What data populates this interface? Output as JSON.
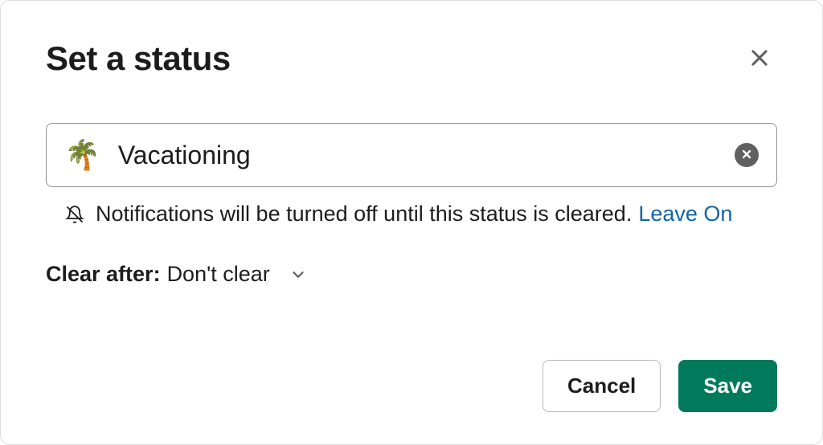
{
  "header": {
    "title": "Set a status"
  },
  "status": {
    "emoji": "🌴",
    "value": "Vacationing"
  },
  "notification": {
    "text": "Notifications will be turned off until this status is cleared.",
    "leave_on_label": "Leave On"
  },
  "clear_after": {
    "label": "Clear after:",
    "value": "Don't clear"
  },
  "footer": {
    "cancel_label": "Cancel",
    "save_label": "Save"
  }
}
